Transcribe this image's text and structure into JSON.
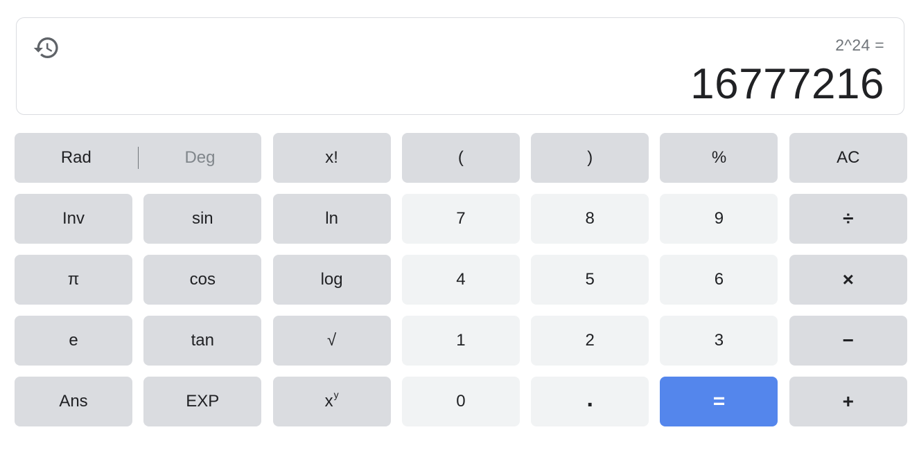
{
  "display": {
    "expression": "2^24 =",
    "result": "16777216",
    "history_icon": "history-icon"
  },
  "mode": {
    "rad": "Rad",
    "deg": "Deg",
    "active": "Rad"
  },
  "keys": {
    "factorial": "x!",
    "lparen": "(",
    "rparen": ")",
    "percent": "%",
    "clear": "AC",
    "inv": "Inv",
    "sin": "sin",
    "ln": "ln",
    "seven": "7",
    "eight": "8",
    "nine": "9",
    "divide": "÷",
    "pi": "π",
    "cos": "cos",
    "log": "log",
    "four": "4",
    "five": "5",
    "six": "6",
    "multiply": "×",
    "e": "e",
    "tan": "tan",
    "sqrt": "√",
    "one": "1",
    "two": "2",
    "three": "3",
    "minus": "−",
    "ans": "Ans",
    "exp": "EXP",
    "power_base": "x",
    "power_exp": "y",
    "zero": "0",
    "decimal": ".",
    "equals": "=",
    "plus": "+"
  },
  "colors": {
    "function_key": "#dadce0",
    "number_key": "#f1f3f4",
    "equals_key": "#5486ec",
    "text": "#202124",
    "muted_text": "#70757a"
  }
}
